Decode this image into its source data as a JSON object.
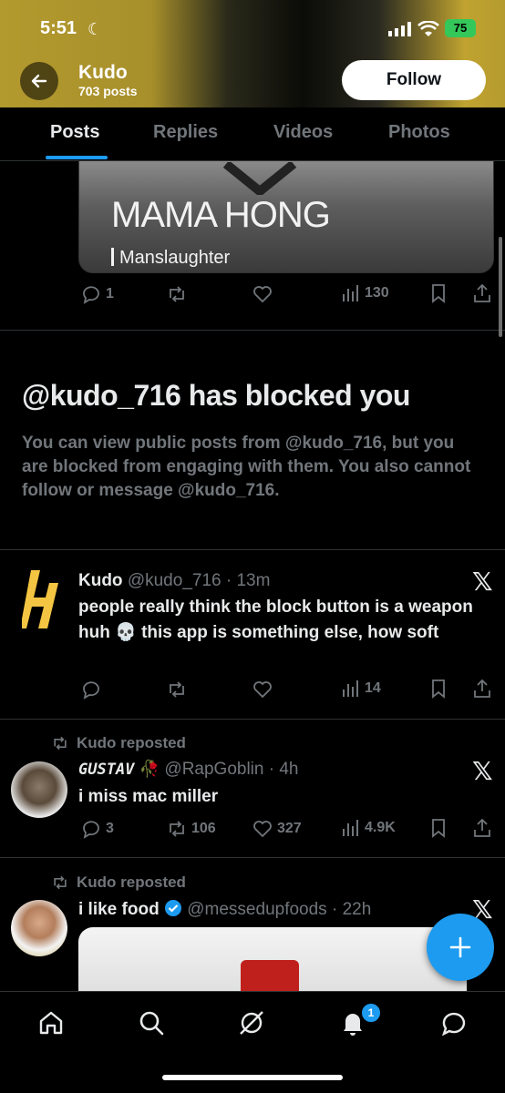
{
  "status_bar": {
    "time": "5:51",
    "battery": "75"
  },
  "header": {
    "name": "Kudo",
    "posts": "703 posts",
    "follow_label": "Follow"
  },
  "tabs": [
    {
      "label": "Posts"
    },
    {
      "label": "Replies"
    },
    {
      "label": "Videos"
    },
    {
      "label": "Photos"
    }
  ],
  "first_post": {
    "media_text_main": "MAMA HONG",
    "media_text_sub": "Manslaughter",
    "replies": "1",
    "views": "130"
  },
  "blocked": {
    "title": "@kudo_716 has blocked you",
    "description": "You can view public posts from @kudo_716, but you are blocked from engaging with them. You also cannot follow or message @kudo_716."
  },
  "post2": {
    "name": "Kudo",
    "handle_time": "@kudo_716 · 13m",
    "text_a": "people really think the block button is a weapon huh",
    "emoji": "💀",
    "text_b": "this app is something else, how soft",
    "views": "14"
  },
  "post3": {
    "repost_label": "Kudo reposted",
    "name": "GUSTAV",
    "handle_time": "@RapGoblin · 4h",
    "text": "i miss mac miller",
    "replies": "3",
    "reposts": "106",
    "likes": "327",
    "views": "4.9K"
  },
  "post4": {
    "repost_label": "Kudo reposted",
    "name": "i like food",
    "handle_time": "@messedupfoods · 22h"
  },
  "notifications_badge": "1",
  "colors": {
    "accent": "#1d9bf0",
    "header_gold": "#b39a2e"
  }
}
